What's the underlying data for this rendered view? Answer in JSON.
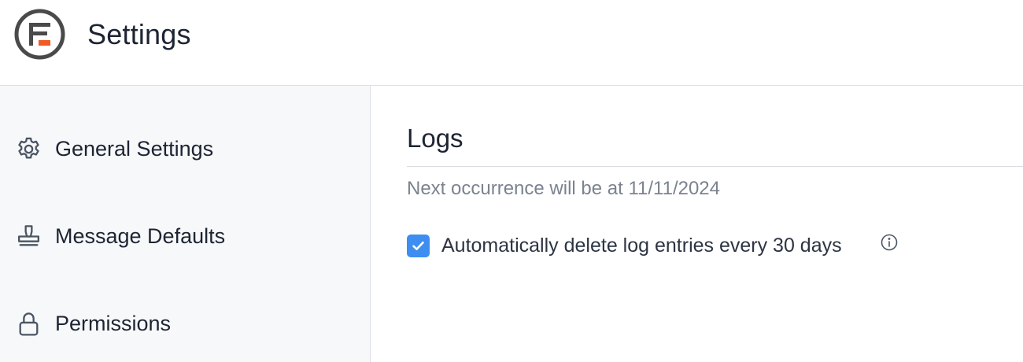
{
  "header": {
    "title": "Settings",
    "logo_icon": "formidable-logo-icon",
    "logo_accent": "#f15a24"
  },
  "sidebar": {
    "items": [
      {
        "label": "General Settings",
        "icon": "gear-icon"
      },
      {
        "label": "Message Defaults",
        "icon": "stamp-icon"
      },
      {
        "label": "Permissions",
        "icon": "lock-icon"
      }
    ]
  },
  "main": {
    "section_title": "Logs",
    "next_occurrence": "Next occurrence will be at 11/11/2024",
    "auto_delete": {
      "label": "Automatically delete log entries every 30 days",
      "checked": true,
      "info_icon": "info-icon"
    }
  },
  "colors": {
    "accent": "#3d8ef0",
    "text": "#1d2433",
    "muted_text": "#7b8290",
    "sidebar_bg": "#f7f8fa"
  }
}
